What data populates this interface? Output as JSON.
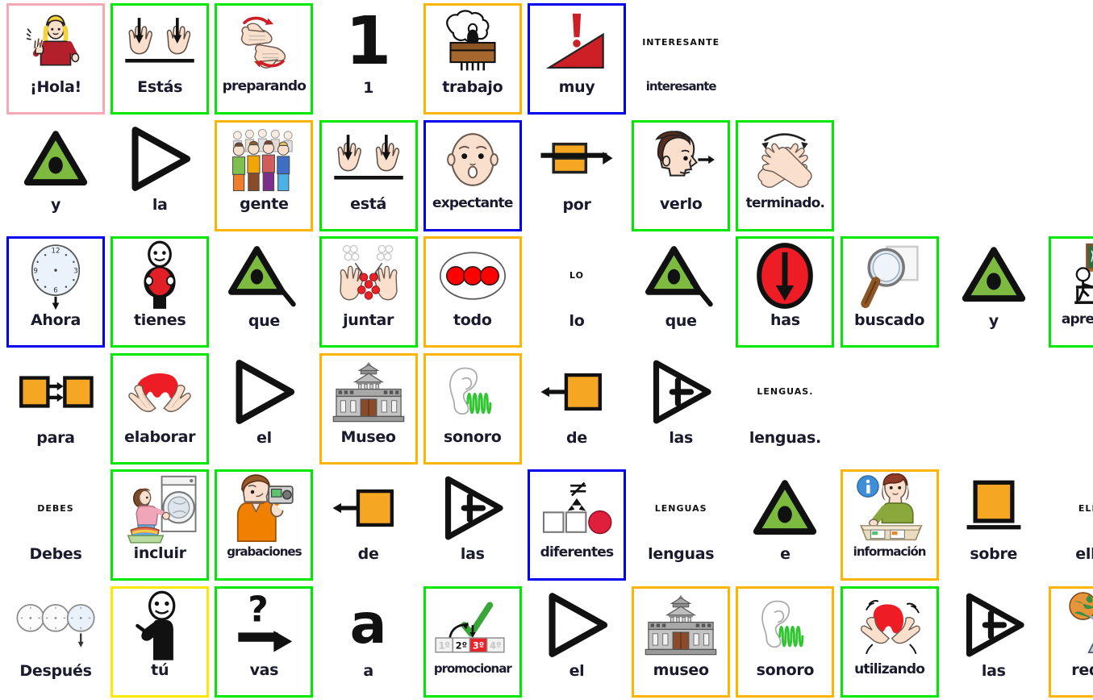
{
  "document": {
    "type": "pictogram-sentence-board",
    "language": "es",
    "sentence": "¡Hola! Estás preparando 1 trabajo muy interesante y la gente está expectante por verlo terminado. Ahora tienes que juntar todo lo que has buscado y aprendido para elaborar el Museo sonoro de las lenguas. Debes incluir grabaciones de las diferentes lenguas e información sobre ellas. Después tú vas a promocionar el museo sonoro utilizando las redes."
  },
  "frame_colors": {
    "pink": "#f4a9b4",
    "green": "#00e800",
    "orange": "#ffb400",
    "blue": "#0000ee",
    "yellow": "#ffe800",
    "none": "none"
  },
  "rows": [
    {
      "index": 0,
      "cells": [
        {
          "label": "¡Hola!",
          "frame": "pink",
          "icon": "girl-waving-icon",
          "caption": null
        },
        {
          "label": "Estás",
          "frame": "green",
          "icon": "hands-down-line-icon",
          "caption": null
        },
        {
          "label": "preparando",
          "frame": "green",
          "icon": "hands-rotating-icon",
          "caption": null
        },
        {
          "label": "1",
          "frame": "none",
          "icon": "numeral-one-icon",
          "caption": null
        },
        {
          "label": "trabajo",
          "frame": "orange",
          "icon": "desk-worker-icon",
          "caption": null
        },
        {
          "label": "muy",
          "frame": "blue",
          "icon": "exclamation-ramp-icon",
          "caption": null
        },
        {
          "label": "interesante",
          "frame": "none",
          "icon": "text-word-icon",
          "caption": "INTERESANTE"
        }
      ]
    },
    {
      "index": 1,
      "cells": [
        {
          "label": "y",
          "frame": "none",
          "icon": "green-triangle-icon",
          "caption": null
        },
        {
          "label": "la",
          "frame": "none",
          "icon": "outline-triangle-icon",
          "caption": null
        },
        {
          "label": "gente",
          "frame": "orange",
          "icon": "crowd-people-icon",
          "caption": null
        },
        {
          "label": "está",
          "frame": "green",
          "icon": "hands-down-line-icon",
          "caption": null
        },
        {
          "label": "expectante",
          "frame": "blue",
          "icon": "surprised-face-icon",
          "caption": null
        },
        {
          "label": "por",
          "frame": "none",
          "icon": "orange-bars-arrow-icon",
          "caption": null
        },
        {
          "label": "verlo",
          "frame": "green",
          "icon": "head-looking-icon",
          "caption": null
        },
        {
          "label": "terminado.",
          "frame": "green",
          "icon": "crossed-hands-icon",
          "caption": null
        }
      ]
    },
    {
      "index": 2,
      "cells": [
        {
          "label": "Ahora",
          "frame": "blue",
          "icon": "clock-down-arrow-icon",
          "caption": null
        },
        {
          "label": "tienes",
          "frame": "green",
          "icon": "person-holding-icon",
          "caption": null
        },
        {
          "label": "que",
          "frame": "none",
          "icon": "green-triangle-tail-icon",
          "caption": null
        },
        {
          "label": "juntar",
          "frame": "green",
          "icon": "hands-gathering-icon",
          "caption": null
        },
        {
          "label": "todo",
          "frame": "orange",
          "icon": "three-dots-circle-icon",
          "caption": null
        },
        {
          "label": "lo",
          "frame": "none",
          "icon": "text-word-icon",
          "caption": "LO"
        },
        {
          "label": "que",
          "frame": "none",
          "icon": "green-triangle-tail-icon",
          "caption": null
        },
        {
          "label": "has",
          "frame": "green",
          "icon": "red-circle-down-icon",
          "caption": null
        },
        {
          "label": "buscado",
          "frame": "green",
          "icon": "magnifier-icon",
          "caption": null
        },
        {
          "label": "y",
          "frame": "none",
          "icon": "green-triangle-icon",
          "caption": null
        },
        {
          "label": "aprendido",
          "frame": "green",
          "icon": "classroom-icon",
          "caption": null
        }
      ]
    },
    {
      "index": 3,
      "cells": [
        {
          "label": "para",
          "frame": "none",
          "icon": "two-squares-arrows-icon",
          "caption": null
        },
        {
          "label": "elaborar",
          "frame": "green",
          "icon": "hands-shaping-icon",
          "caption": null
        },
        {
          "label": "el",
          "frame": "none",
          "icon": "outline-triangle-icon",
          "caption": null
        },
        {
          "label": "Museo",
          "frame": "orange",
          "icon": "museum-building-icon",
          "caption": null
        },
        {
          "label": "sonoro",
          "frame": "orange",
          "icon": "ear-soundwave-icon",
          "caption": null
        },
        {
          "label": "de",
          "frame": "none",
          "icon": "square-left-arrow-icon",
          "caption": null
        },
        {
          "label": "las",
          "frame": "none",
          "icon": "triangle-plus-icon",
          "caption": null
        },
        {
          "label": "lenguas.",
          "frame": "none",
          "icon": "text-word-icon",
          "caption": "LENGUAS."
        }
      ]
    },
    {
      "index": 4,
      "cells": [
        {
          "label": "Debes",
          "frame": "none",
          "icon": "text-word-icon",
          "caption": "DEBES"
        },
        {
          "label": "incluir",
          "frame": "green",
          "icon": "laundry-loading-icon",
          "caption": null
        },
        {
          "label": "grabaciones",
          "frame": "green",
          "icon": "camcorder-person-icon",
          "caption": null
        },
        {
          "label": "de",
          "frame": "none",
          "icon": "square-left-arrow-icon",
          "caption": null
        },
        {
          "label": "las",
          "frame": "none",
          "icon": "triangle-plus-icon",
          "caption": null
        },
        {
          "label": "diferentes",
          "frame": "blue",
          "icon": "different-shapes-icon",
          "caption": null
        },
        {
          "label": "lenguas",
          "frame": "none",
          "icon": "text-word-icon",
          "caption": "LENGUAS"
        },
        {
          "label": "e",
          "frame": "none",
          "icon": "green-triangle-icon",
          "caption": null
        },
        {
          "label": "información",
          "frame": "orange",
          "icon": "info-desk-icon",
          "caption": null
        },
        {
          "label": "sobre",
          "frame": "none",
          "icon": "square-on-line-icon",
          "caption": null
        },
        {
          "label": "ellas.",
          "frame": "none",
          "icon": "text-word-icon",
          "caption": "ELLAS."
        }
      ]
    },
    {
      "index": 5,
      "cells": [
        {
          "label": "Después",
          "frame": "none",
          "icon": "three-clocks-icon",
          "caption": null
        },
        {
          "label": "tú",
          "frame": "yellow",
          "icon": "person-pointing-icon",
          "caption": null
        },
        {
          "label": "vas",
          "frame": "green",
          "icon": "question-arrow-icon",
          "caption": null
        },
        {
          "label": "a",
          "frame": "none",
          "icon": "letter-a-icon",
          "caption": null
        },
        {
          "label": "promocionar",
          "frame": "green",
          "icon": "ranking-check-icon",
          "caption": null
        },
        {
          "label": "el",
          "frame": "none",
          "icon": "outline-triangle-icon",
          "caption": null
        },
        {
          "label": "museo",
          "frame": "orange",
          "icon": "museum-building-icon",
          "caption": null
        },
        {
          "label": "sonoro",
          "frame": "orange",
          "icon": "ear-soundwave-icon",
          "caption": null
        },
        {
          "label": "utilizando",
          "frame": "green",
          "icon": "hands-using-icon",
          "caption": null
        },
        {
          "label": "las",
          "frame": "none",
          "icon": "triangle-plus-icon",
          "caption": null
        },
        {
          "label": "redes.",
          "frame": "orange",
          "icon": "globe-computer-icon",
          "caption": null
        }
      ]
    }
  ],
  "ranking_icon": {
    "steps": [
      "1º",
      "2º",
      "3º",
      "4º"
    ],
    "highlighted": "3º"
  }
}
